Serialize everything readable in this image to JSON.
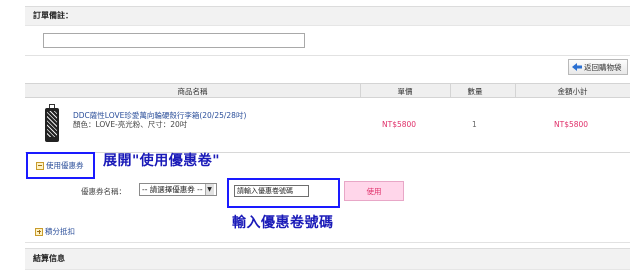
{
  "remark": {
    "title": "訂單備註：",
    "value": ""
  },
  "back_button": {
    "label": "返回購物袋"
  },
  "table": {
    "headers": [
      "商品名稱",
      "單價",
      "數量",
      "金額小計"
    ],
    "row": {
      "name": "DDC薩性LOVE珍愛萬向輪硬殼行李箱(20/25/28吋)",
      "spec": "顏色：LOVE-亮光粉、尺寸：20吋",
      "price": "NT$5800",
      "qty": "1",
      "subtotal": "NT$5800"
    }
  },
  "coupon": {
    "toggle_label": "使用優惠券",
    "field_label": "優惠券名稱：",
    "select_value": "-- 請選擇優惠券 --",
    "code_placeholder": "請輸入優惠卷號碼",
    "use_button": "使用"
  },
  "annotations": {
    "expand_hint": "展開\"使用優惠卷\"",
    "enter_hint": "輸入優惠卷號碼"
  },
  "points": {
    "toggle_label": "積分抵扣"
  },
  "summary": {
    "title": "結算信息"
  },
  "colors": {
    "price": "#e0306a",
    "link": "#2a4e9a",
    "annotation": "#1a1ab8",
    "highlight_box": "#1a1aff"
  }
}
